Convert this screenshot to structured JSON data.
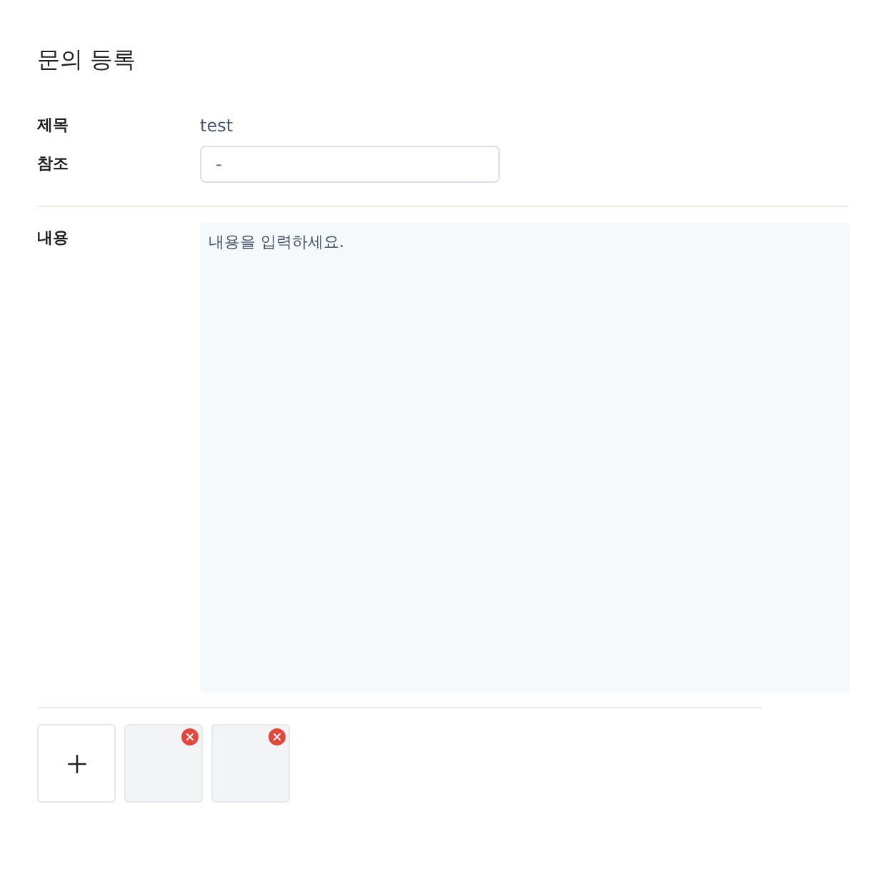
{
  "title": "문의 등록",
  "fields": [
    {
      "label": "제목",
      "kind": "text",
      "value": "test"
    },
    {
      "label": "참조",
      "kind": "input",
      "value": "-"
    }
  ],
  "content": {
    "label": "내용",
    "placeholder": "내용을 입력하세요."
  },
  "attachments": [
    {
      "kind": "image"
    },
    {
      "kind": "image"
    }
  ]
}
